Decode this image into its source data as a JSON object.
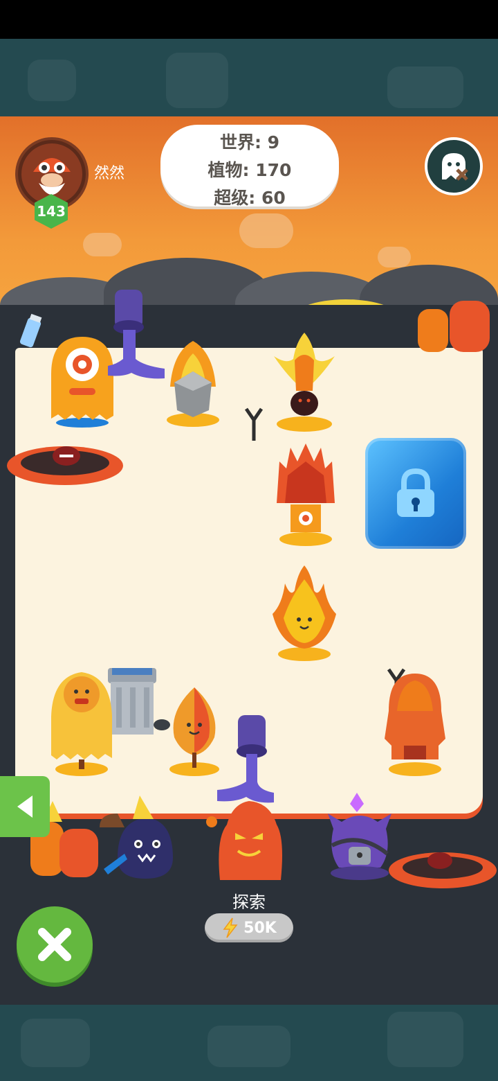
{
  "player": {
    "name": "然然",
    "level": "143"
  },
  "stats": {
    "world": "世界: 9",
    "plants": "植物: 170",
    "super": "超级: 60"
  },
  "explore": {
    "label": "探索",
    "cost": "50K"
  },
  "colors": {
    "sky": "#f39a3a",
    "field": "#fcf3df",
    "dark": "#2b3139",
    "accentGreen": "#64b83f",
    "lava": "#e8552a",
    "ice": "#2f8fe3"
  },
  "icons": {
    "menu": "ghost-cross-icon",
    "back": "chevron-left-icon",
    "close": "close-x-icon",
    "energy": "lightning-icon",
    "lock": "padlock-icon"
  }
}
